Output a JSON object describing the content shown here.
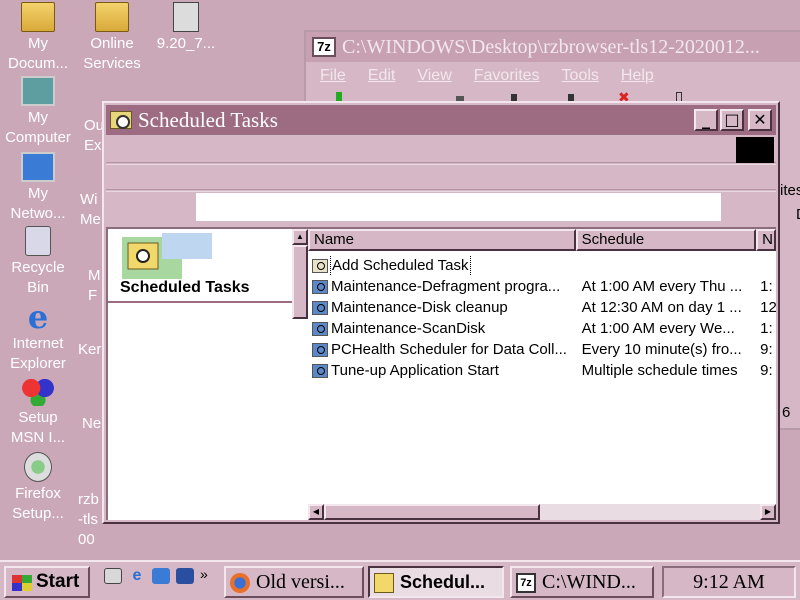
{
  "desktop": {
    "icons": [
      {
        "label": "My\nDocum..."
      },
      {
        "label": "My\nComputer"
      },
      {
        "label": "My\nNetwo..."
      },
      {
        "label": "Recycle\nBin"
      },
      {
        "label": "Internet\nExplorer"
      },
      {
        "label": "Setup\nMSN I..."
      },
      {
        "label": "Firefox\nSetup..."
      }
    ],
    "col2": [
      {
        "label": "Online\nServices"
      },
      {
        "label": "9.20_7..."
      }
    ],
    "partial_labels": [
      "Ou\nEx",
      "Wi\nMe",
      "M\nF",
      "Ker",
      "Ne",
      "rzb\n-tls\n00"
    ]
  },
  "bg_window": {
    "title": "C:\\WINDOWS\\Desktop\\rzbrowser-tls12-2020012...",
    "icon_label": "7z",
    "menu": [
      "File",
      "Edit",
      "View",
      "Favorites",
      "Tools",
      "Help"
    ],
    "ghost_text": [
      "ites",
      "D",
      "6"
    ]
  },
  "window": {
    "title": "Scheduled Tasks",
    "minimize": "_",
    "maximize": "□",
    "close": "✕"
  },
  "left_panel": {
    "title": "Scheduled Tasks"
  },
  "list": {
    "columns": [
      "Name",
      "Schedule",
      "N"
    ],
    "rows": [
      {
        "name": "Add Scheduled Task",
        "schedule": "",
        "next": "",
        "icon": "add-task-icon"
      },
      {
        "name": "Maintenance-Defragment progra...",
        "schedule": "At 1:00 AM every Thu ...",
        "next": "1:",
        "icon": "task-icon"
      },
      {
        "name": "Maintenance-Disk cleanup",
        "schedule": "At 12:30 AM on day 1 ...",
        "next": "12",
        "icon": "task-icon"
      },
      {
        "name": "Maintenance-ScanDisk",
        "schedule": "At 1:00 AM every We...",
        "next": "1:",
        "icon": "task-icon"
      },
      {
        "name": "PCHealth Scheduler for Data Coll...",
        "schedule": "Every 10 minute(s) fro...",
        "next": "9:",
        "icon": "task-icon"
      },
      {
        "name": "Tune-up Application Start",
        "schedule": "Multiple schedule times",
        "next": "9:",
        "icon": "task-icon"
      }
    ]
  },
  "taskbar": {
    "start_label": "Start",
    "chevron": "»",
    "tasks": [
      {
        "label": "Old versi...",
        "icon": "firefox-icon"
      },
      {
        "label": "Schedul...",
        "icon": "scheduled-tasks-icon"
      },
      {
        "label": "C:\\WIND...",
        "icon": "7zip-icon"
      }
    ],
    "clock": "9:12 AM"
  },
  "colors": {
    "desktop": "#CBA8B8",
    "title_active": "#9E6C82",
    "face": "#D5B7C5"
  }
}
